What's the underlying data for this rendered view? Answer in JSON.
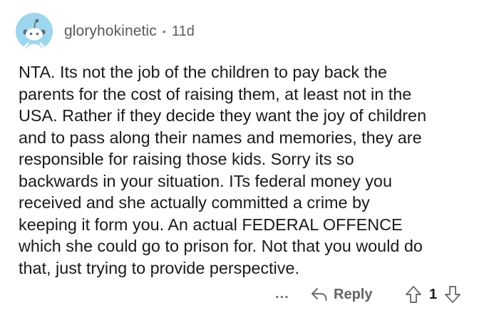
{
  "comment": {
    "avatar_icon": "reddit-snoo-avatar-icon",
    "avatar_color": "#9ed6ee",
    "author": "gloryhokinetic",
    "separator": "•",
    "age": "11d",
    "body": "NTA. Its not the job of the children to pay back the\nparents for the cost of raising them, at least not in the\nUSA.  Rather if they decide they want the joy of children\nand to pass along their names and memories, they are\nresponsible for raising those kids. Sorry its so\nbackwards in your situation. ITs federal money you\nreceived and she actually committed a crime by\nkeeping it form you. An actual FEDERAL OFFENCE\nwhich she could go to prison for. Not that you would do\nthat, just trying to provide perspective."
  },
  "actions": {
    "more_label": "...",
    "reply_icon": "reply-arrow-icon",
    "reply_label": "Reply",
    "upvote_icon": "upvote-arrow-icon",
    "vote_count": "1",
    "downvote_icon": "downvote-arrow-icon"
  }
}
